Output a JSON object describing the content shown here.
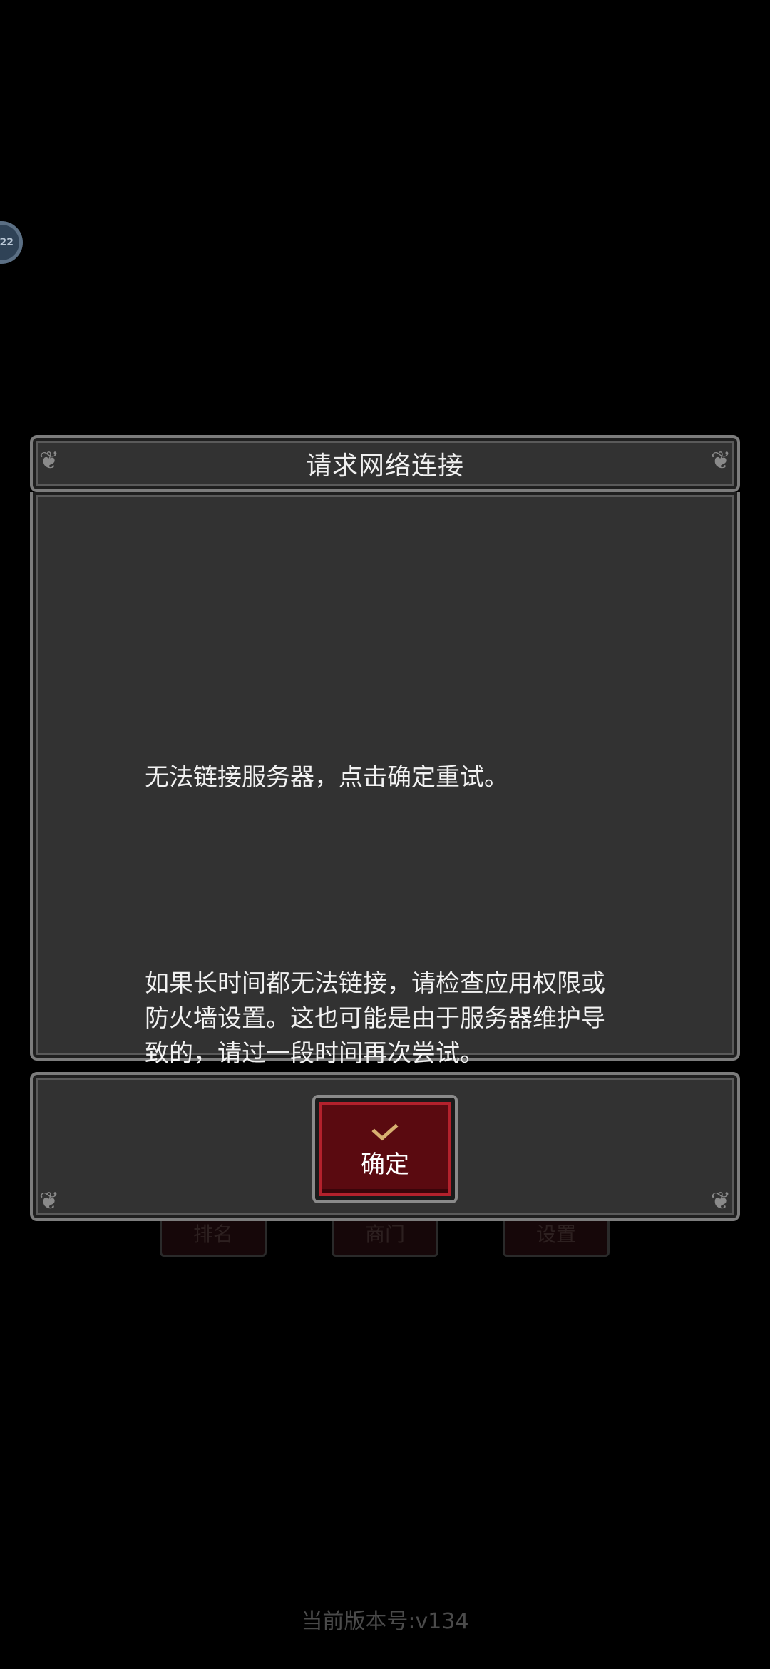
{
  "dialog": {
    "title": "请求网络连接",
    "message_line1": "无法链接服务器，点击确定重试。",
    "message_line2": "如果长时间都无法链接，请检查应用权限或\n防火墙设置。这也可能是由于服务器维护导\n致的，请过一段时间再次尝试。",
    "confirm_label": "确定",
    "confirm_icon": "check-icon"
  },
  "footer": {
    "version_text": "当前版本号:v134"
  },
  "float_badge": {
    "text": "22"
  },
  "background_buttons": [
    {
      "label": "排名"
    },
    {
      "label": "商门"
    },
    {
      "label": "设置"
    }
  ],
  "colors": {
    "background": "#000000",
    "panel": "#323232",
    "panel_border": "#7c7c7c",
    "confirm_fill": "#5a0a10",
    "confirm_border": "#b3212c",
    "check_color": "#d8b070",
    "version_text": "#4a4a4a"
  }
}
